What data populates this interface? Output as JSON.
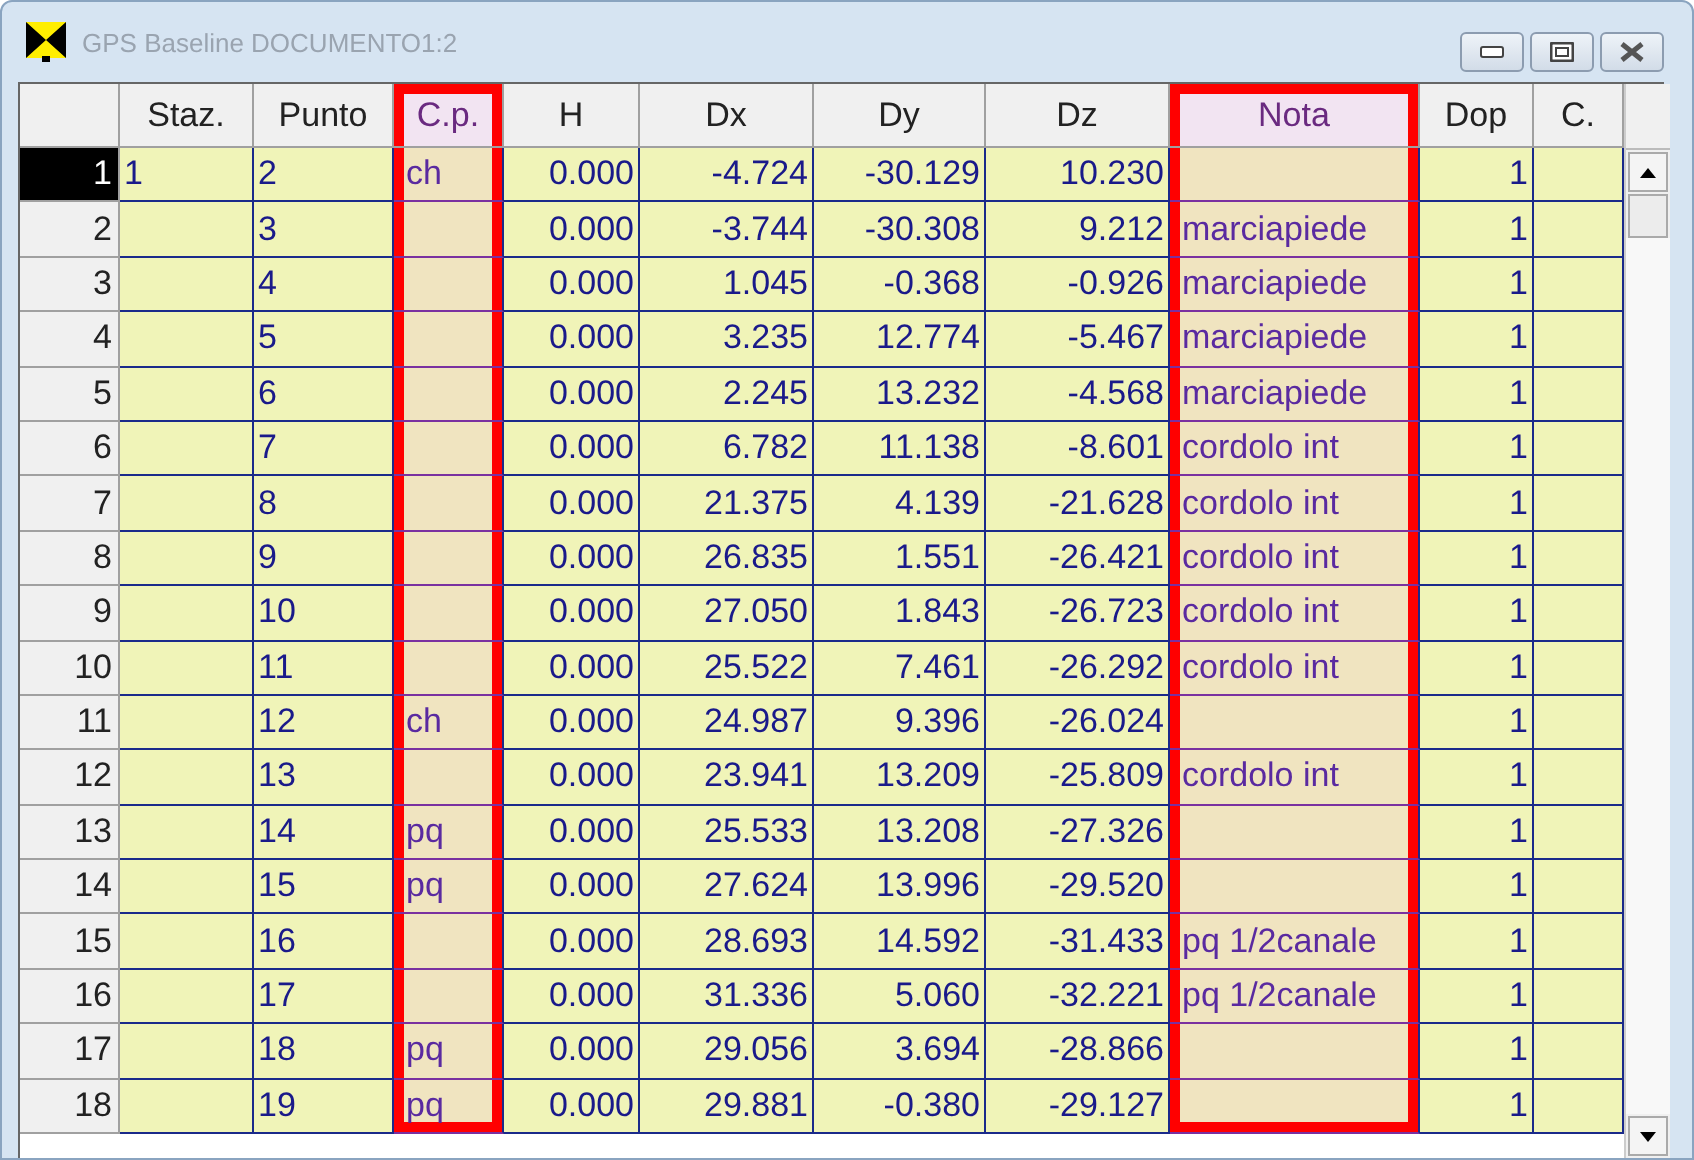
{
  "window": {
    "title": "GPS Baseline DOCUMENTO1:2"
  },
  "columns": [
    {
      "label": "Staz.",
      "highlighted": false
    },
    {
      "label": "Punto",
      "highlighted": false
    },
    {
      "label": "C.p.",
      "highlighted": true
    },
    {
      "label": "H",
      "highlighted": false
    },
    {
      "label": "Dx",
      "highlighted": false
    },
    {
      "label": "Dy",
      "highlighted": false
    },
    {
      "label": "Dz",
      "highlighted": false
    },
    {
      "label": "Nota",
      "highlighted": true
    },
    {
      "label": "Dop",
      "highlighted": false
    },
    {
      "label": "C.",
      "highlighted": false
    }
  ],
  "rows": [
    {
      "number": "1",
      "selected": true,
      "cells": [
        "1",
        "2",
        "ch",
        "0.000",
        "-4.724",
        "-30.129",
        "10.230",
        null,
        "1",
        null
      ]
    },
    {
      "number": "2",
      "selected": false,
      "cells": [
        null,
        "3",
        null,
        "0.000",
        "-3.744",
        "-30.308",
        "9.212",
        "marciapiede",
        "1",
        null
      ]
    },
    {
      "number": "3",
      "selected": false,
      "cells": [
        null,
        "4",
        null,
        "0.000",
        "1.045",
        "-0.368",
        "-0.926",
        "marciapiede",
        "1",
        null
      ]
    },
    {
      "number": "4",
      "selected": false,
      "cells": [
        null,
        "5",
        null,
        "0.000",
        "3.235",
        "12.774",
        "-5.467",
        "marciapiede",
        "1",
        null
      ]
    },
    {
      "number": "5",
      "selected": false,
      "cells": [
        null,
        "6",
        null,
        "0.000",
        "2.245",
        "13.232",
        "-4.568",
        "marciapiede",
        "1",
        null
      ]
    },
    {
      "number": "6",
      "selected": false,
      "cells": [
        null,
        "7",
        null,
        "0.000",
        "6.782",
        "11.138",
        "-8.601",
        "cordolo int",
        "1",
        null
      ]
    },
    {
      "number": "7",
      "selected": false,
      "cells": [
        null,
        "8",
        null,
        "0.000",
        "21.375",
        "4.139",
        "-21.628",
        "cordolo int",
        "1",
        null
      ]
    },
    {
      "number": "8",
      "selected": false,
      "cells": [
        null,
        "9",
        null,
        "0.000",
        "26.835",
        "1.551",
        "-26.421",
        "cordolo int",
        "1",
        null
      ]
    },
    {
      "number": "9",
      "selected": false,
      "cells": [
        null,
        "10",
        null,
        "0.000",
        "27.050",
        "1.843",
        "-26.723",
        "cordolo int",
        "1",
        null
      ]
    },
    {
      "number": "10",
      "selected": false,
      "cells": [
        null,
        "11",
        null,
        "0.000",
        "25.522",
        "7.461",
        "-26.292",
        "cordolo int",
        "1",
        null
      ]
    },
    {
      "number": "11",
      "selected": false,
      "cells": [
        null,
        "12",
        "ch",
        "0.000",
        "24.987",
        "9.396",
        "-26.024",
        null,
        "1",
        null
      ]
    },
    {
      "number": "12",
      "selected": false,
      "cells": [
        null,
        "13",
        null,
        "0.000",
        "23.941",
        "13.209",
        "-25.809",
        "cordolo int",
        "1",
        null
      ]
    },
    {
      "number": "13",
      "selected": false,
      "cells": [
        null,
        "14",
        "pq",
        "0.000",
        "25.533",
        "13.208",
        "-27.326",
        null,
        "1",
        null
      ]
    },
    {
      "number": "14",
      "selected": false,
      "cells": [
        null,
        "15",
        "pq",
        "0.000",
        "27.624",
        "13.996",
        "-29.520",
        null,
        "1",
        null
      ]
    },
    {
      "number": "15",
      "selected": false,
      "cells": [
        null,
        "16",
        null,
        "0.000",
        "28.693",
        "14.592",
        "-31.433",
        "pq 1/2canale",
        "1",
        null
      ]
    },
    {
      "number": "16",
      "selected": false,
      "cells": [
        null,
        "17",
        null,
        "0.000",
        "31.336",
        "5.060",
        "-32.221",
        "pq 1/2canale",
        "1",
        null
      ]
    },
    {
      "number": "17",
      "selected": false,
      "cells": [
        null,
        "18",
        "pq",
        "0.000",
        "29.056",
        "3.694",
        "-28.866",
        null,
        "1",
        null
      ]
    },
    {
      "number": "18",
      "selected": false,
      "cells": [
        null,
        "19",
        "pq",
        "0.000",
        "29.881",
        "-0.380",
        "-29.127",
        null,
        "1",
        null
      ]
    }
  ]
}
